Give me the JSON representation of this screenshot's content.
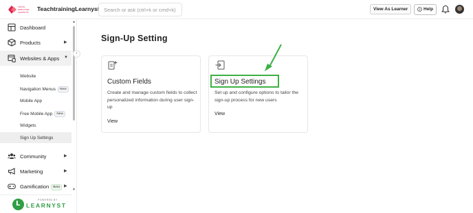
{
  "header": {
    "logo_text": "TEACH EMPLOYEE LEARNYST",
    "brand": "TeachtrainingLearnyst",
    "search_placeholder": "Search or ask (ctrl+k or cmd+k)",
    "view_as_learner": "View As Learner",
    "help": "Help",
    "icons": [
      "bell-icon",
      "avatar"
    ]
  },
  "sidebar": {
    "items": [
      {
        "label": "Dashboard",
        "icon": "dashboard-icon"
      },
      {
        "label": "Products",
        "icon": "box-icon"
      },
      {
        "label": "Websites & Apps",
        "icon": "website-icon"
      },
      {
        "label": "Community",
        "icon": "community-icon"
      },
      {
        "label": "Marketing",
        "icon": "megaphone-icon"
      },
      {
        "label": "Gamification",
        "icon": "gamepad-icon",
        "badge": "Beta"
      }
    ],
    "sub_items": [
      {
        "label": "Website"
      },
      {
        "label": "Navigation Menus",
        "badge": "New"
      },
      {
        "label": "Mobile App"
      },
      {
        "label": "Free Mobile App",
        "badge": "New"
      },
      {
        "label": "Widgets"
      },
      {
        "label": "Sign Up Settings"
      }
    ],
    "powered_by": "POWERED BY",
    "powered_name": "LEARNYST"
  },
  "main": {
    "title": "Sign-Up Setting",
    "cards": [
      {
        "title": "Custom Fields",
        "description": "Create and manage custom fields to collect personalized information during user sign-up",
        "action": "View",
        "icon": "custom-fields-icon"
      },
      {
        "title": "Sign Up Settings",
        "description": "Set up and configure options to tailor the sign-up process for new users",
        "action": "View",
        "icon": "signup-settings-icon"
      }
    ]
  },
  "annotation": {
    "highlight_color": "#3cb043"
  },
  "colors": {
    "accent_green": "#2f9e44",
    "logo_red": "#e0234e"
  }
}
